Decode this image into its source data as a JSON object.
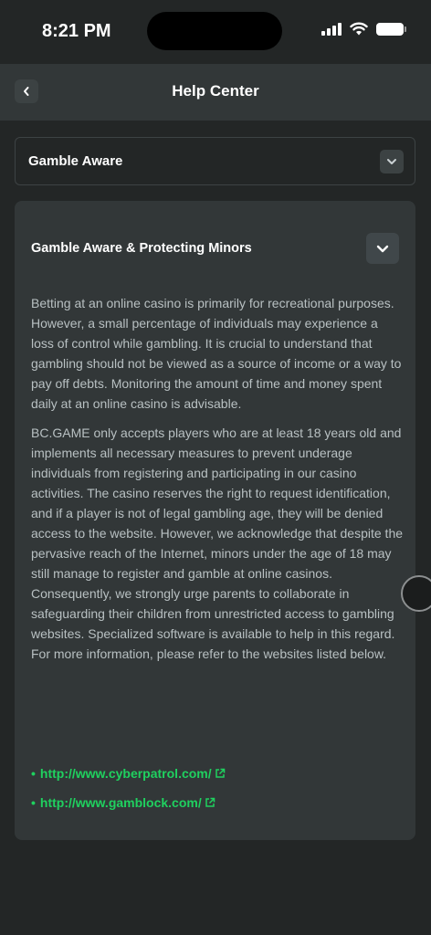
{
  "status_bar": {
    "time": "8:21 PM"
  },
  "header": {
    "title": "Help Center"
  },
  "collapsed_section": {
    "label": "Gamble Aware"
  },
  "open_section": {
    "title": "Gamble Aware & Protecting Minors",
    "paragraph1": "Betting at an online casino is primarily for recreational purposes. However, a small percentage of individuals may experience a loss of control while gambling. It is crucial to understand that gambling should not be viewed as a source of income or a way to pay off debts. Monitoring the amount of time and money spent daily at an online casino is advisable.",
    "paragraph2": "BC.GAME only accepts players who are at least 18 years old and implements all necessary measures to prevent underage individuals from registering and participating in our casino activities. The casino reserves the right to request identification, and if a player is not of legal gambling age, they will be denied access to the website. However, we acknowledge that despite the pervasive reach of the Internet, minors under the age of 18 may still manage to register and gamble at online casinos. Consequently, we strongly urge parents to collaborate in safeguarding their children from unrestricted access to gambling websites. Specialized software is available to help in this regard. For more information, please refer to the websites listed below.",
    "links": [
      {
        "text": "http://www.cyberpatrol.com/"
      },
      {
        "text": "http://www.gamblock.com/"
      }
    ]
  },
  "icons": {
    "back": "chevron-left-icon",
    "collapsed_toggle": "chevron-down-icon",
    "open_toggle": "chevron-down-icon",
    "external": "external-link-icon"
  },
  "colors": {
    "background": "#232626",
    "card": "#323738",
    "link": "#1fd15f",
    "text_muted": "#b8c0c2"
  }
}
